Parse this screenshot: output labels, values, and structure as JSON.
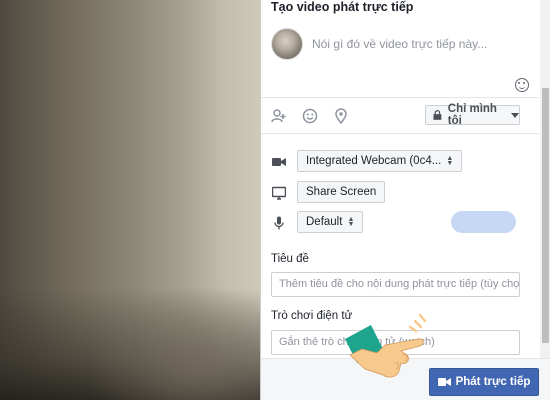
{
  "panel": {
    "title": "Tạo video phát trực tiếp",
    "composer_placeholder": "Nói gì đó về video trực tiếp này...",
    "privacy_label": "Chỉ mình tôi",
    "icons": [
      "tag-people-icon",
      "feeling-icon",
      "location-icon",
      "emoji-icon",
      "lock-icon"
    ]
  },
  "sources": {
    "camera": "Integrated Webcam (0c4...",
    "screen": "Share Screen",
    "mic": "Default"
  },
  "fields": {
    "title_label": "Tiêu đề",
    "title_placeholder": "Thêm tiêu đề cho nội dung phát trực tiếp (tùy chọn)",
    "game_label": "Trò chơi điện tử",
    "game_placeholder": "Gắn thẻ trò chơi điện tử (watch)"
  },
  "footer": {
    "go_live_label": "Phát trực tiếp"
  },
  "colors": {
    "accent": "#4267b2",
    "mic_level": "#c7d8f4"
  }
}
